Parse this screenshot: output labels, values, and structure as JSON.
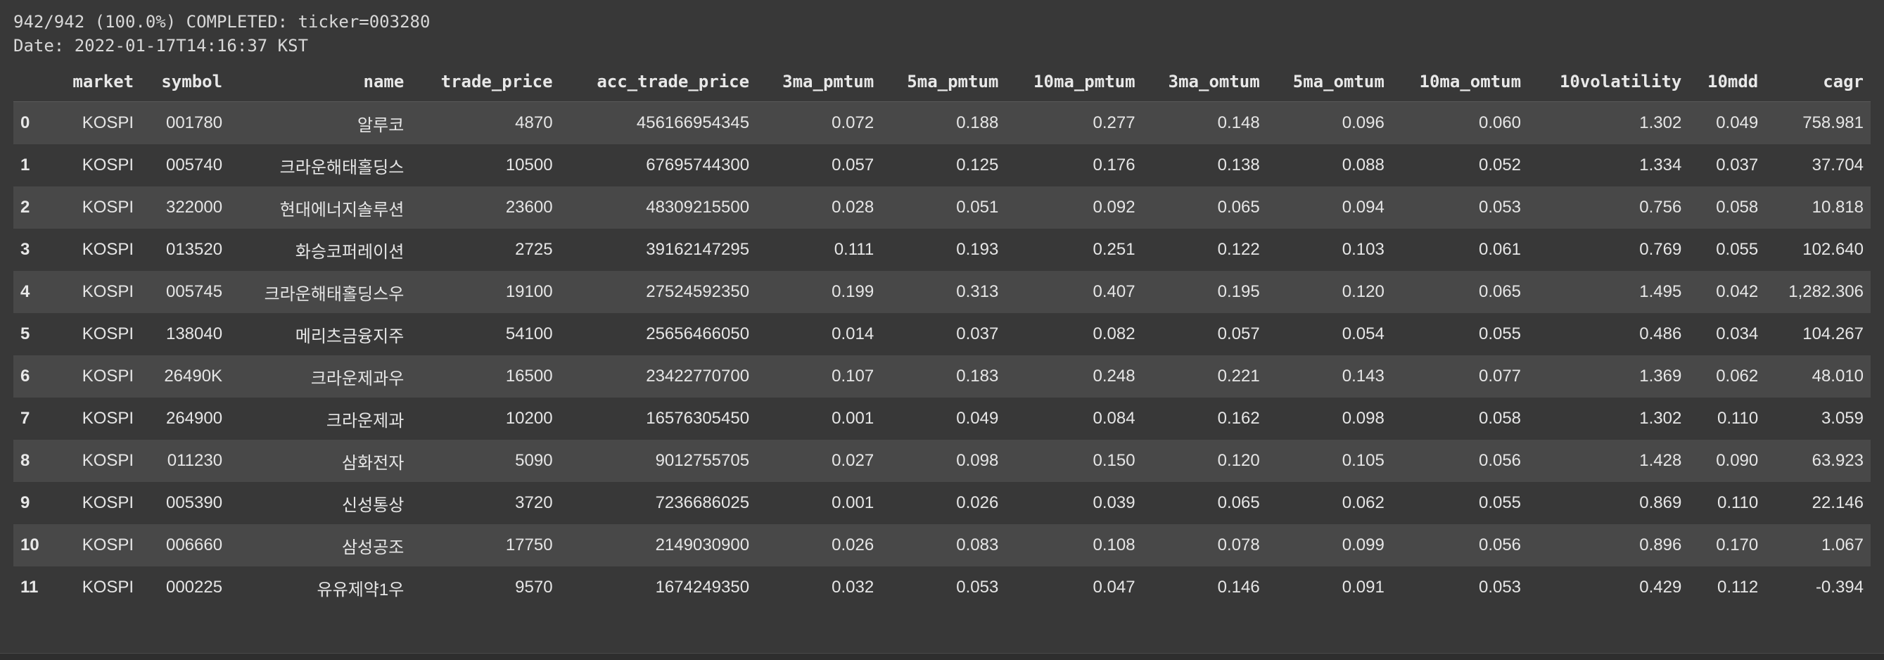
{
  "output": {
    "status_line": "942/942 (100.0%) COMPLETED: ticker=003280",
    "date_line": "Date: 2022-01-17T14:16:37 KST"
  },
  "table": {
    "columns": [
      "",
      "market",
      "symbol",
      "name",
      "trade_price",
      "acc_trade_price",
      "3ma_pmtum",
      "5ma_pmtum",
      "10ma_pmtum",
      "3ma_omtum",
      "5ma_omtum",
      "10ma_omtum",
      "10volatility",
      "10mdd",
      "cagr"
    ],
    "rows": [
      [
        "0",
        "KOSPI",
        "001780",
        "알루코",
        "4870",
        "456166954345",
        "0.072",
        "0.188",
        "0.277",
        "0.148",
        "0.096",
        "0.060",
        "1.302",
        "0.049",
        "758.981"
      ],
      [
        "1",
        "KOSPI",
        "005740",
        "크라운해태홀딩스",
        "10500",
        "67695744300",
        "0.057",
        "0.125",
        "0.176",
        "0.138",
        "0.088",
        "0.052",
        "1.334",
        "0.037",
        "37.704"
      ],
      [
        "2",
        "KOSPI",
        "322000",
        "현대에너지솔루션",
        "23600",
        "48309215500",
        "0.028",
        "0.051",
        "0.092",
        "0.065",
        "0.094",
        "0.053",
        "0.756",
        "0.058",
        "10.818"
      ],
      [
        "3",
        "KOSPI",
        "013520",
        "화승코퍼레이션",
        "2725",
        "39162147295",
        "0.111",
        "0.193",
        "0.251",
        "0.122",
        "0.103",
        "0.061",
        "0.769",
        "0.055",
        "102.640"
      ],
      [
        "4",
        "KOSPI",
        "005745",
        "크라운해태홀딩스우",
        "19100",
        "27524592350",
        "0.199",
        "0.313",
        "0.407",
        "0.195",
        "0.120",
        "0.065",
        "1.495",
        "0.042",
        "1,282.306"
      ],
      [
        "5",
        "KOSPI",
        "138040",
        "메리츠금융지주",
        "54100",
        "25656466050",
        "0.014",
        "0.037",
        "0.082",
        "0.057",
        "0.054",
        "0.055",
        "0.486",
        "0.034",
        "104.267"
      ],
      [
        "6",
        "KOSPI",
        "26490K",
        "크라운제과우",
        "16500",
        "23422770700",
        "0.107",
        "0.183",
        "0.248",
        "0.221",
        "0.143",
        "0.077",
        "1.369",
        "0.062",
        "48.010"
      ],
      [
        "7",
        "KOSPI",
        "264900",
        "크라운제과",
        "10200",
        "16576305450",
        "0.001",
        "0.049",
        "0.084",
        "0.162",
        "0.098",
        "0.058",
        "1.302",
        "0.110",
        "3.059"
      ],
      [
        "8",
        "KOSPI",
        "011230",
        "삼화전자",
        "5090",
        "9012755705",
        "0.027",
        "0.098",
        "0.150",
        "0.120",
        "0.105",
        "0.056",
        "1.428",
        "0.090",
        "63.923"
      ],
      [
        "9",
        "KOSPI",
        "005390",
        "신성통상",
        "3720",
        "7236686025",
        "0.001",
        "0.026",
        "0.039",
        "0.065",
        "0.062",
        "0.055",
        "0.869",
        "0.110",
        "22.146"
      ],
      [
        "10",
        "KOSPI",
        "006660",
        "삼성공조",
        "17750",
        "2149030900",
        "0.026",
        "0.083",
        "0.108",
        "0.078",
        "0.099",
        "0.056",
        "0.896",
        "0.170",
        "1.067"
      ],
      [
        "11",
        "KOSPI",
        "000225",
        "유유제약1우",
        "9570",
        "1674249350",
        "0.032",
        "0.053",
        "0.047",
        "0.146",
        "0.091",
        "0.053",
        "0.429",
        "0.112",
        "-0.394"
      ]
    ]
  }
}
